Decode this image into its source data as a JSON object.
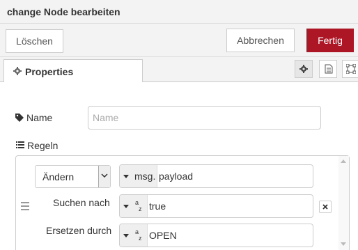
{
  "tray": {
    "title": "change Node bearbeiten"
  },
  "toolbar": {
    "delete_label": "Löschen",
    "cancel_label": "Abbrechen",
    "done_label": "Fertig"
  },
  "tabs": [
    {
      "label": "Properties",
      "icon": "gear-icon",
      "active": true
    },
    {
      "label": "",
      "icon": "gear-icon",
      "active": false
    },
    {
      "label": "",
      "icon": "file-icon",
      "active": false
    },
    {
      "label": "",
      "icon": "frame-icon",
      "active": false
    }
  ],
  "form": {
    "name_label": "Name",
    "name_placeholder": "Name",
    "name_value": "",
    "rules_label": "Regeln"
  },
  "rule": {
    "action": "Ändern",
    "target_prefix": "msg.",
    "target_value": "payload",
    "search_label": "Suchen nach",
    "search_type_icon": "string-az-icon",
    "search_value": "true",
    "replace_label": "Ersetzen durch",
    "replace_type_icon": "string-az-icon",
    "replace_value": "OPEN",
    "type_glyph_top": "a",
    "type_glyph_bottom": "z"
  },
  "colors": {
    "accent": "#ad1625",
    "header_bg": "#f3f3f3",
    "border": "#cccccc"
  }
}
